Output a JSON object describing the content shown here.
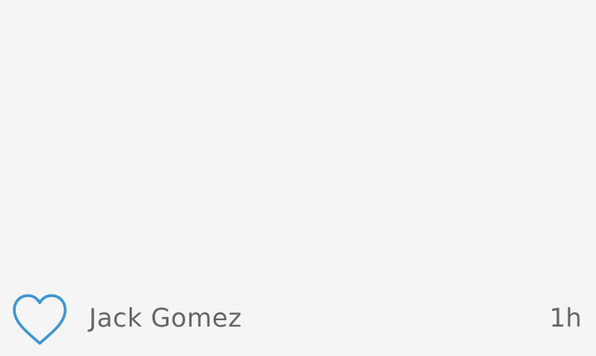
{
  "post": {
    "author": "Jack Gomez",
    "time": "1h",
    "like_icon": "heart-outline-icon",
    "liked": false
  },
  "colors": {
    "background": "#f5f5f5",
    "accent": "#3a97d4",
    "text": "#666666"
  }
}
